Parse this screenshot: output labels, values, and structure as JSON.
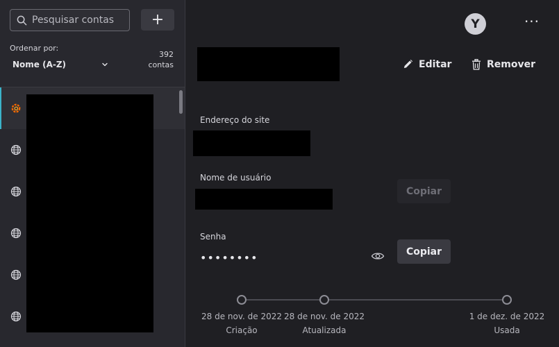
{
  "sidebar": {
    "search": {
      "placeholder": "Pesquisar contas"
    },
    "add_label": "+",
    "sort": {
      "label": "Ordenar por:",
      "value": "Nome (A-Z)"
    },
    "count": {
      "number": "392",
      "unit": "contas"
    },
    "items": [
      {
        "icon": "grafana-icon",
        "active": true
      },
      {
        "icon": "globe-icon",
        "active": false
      },
      {
        "icon": "globe-icon",
        "active": false
      },
      {
        "icon": "globe-icon",
        "active": false
      },
      {
        "icon": "globe-icon",
        "active": false
      },
      {
        "icon": "globe-icon",
        "active": false
      }
    ]
  },
  "header": {
    "avatar_letter": "Y",
    "more_label": "···",
    "edit_label": "Editar",
    "remove_label": "Remover"
  },
  "fields": {
    "site": {
      "label": "Endereço do site"
    },
    "username": {
      "label": "Nome de usuário",
      "copy_label": "Copiar"
    },
    "password": {
      "label": "Senha",
      "value": "••••••••",
      "copy_label": "Copiar"
    }
  },
  "timeline": [
    {
      "date": "28 de nov. de 2022",
      "label": "Criação"
    },
    {
      "date": "28 de nov. de 2022",
      "label": "Atualizada"
    },
    {
      "date": "1 de dez. de 2022",
      "label": "Usada"
    }
  ],
  "colors": {
    "accent": "#3bb3c9",
    "grafana": "#f46800",
    "background": "#1f1f23",
    "sidebar": "#28282e"
  }
}
